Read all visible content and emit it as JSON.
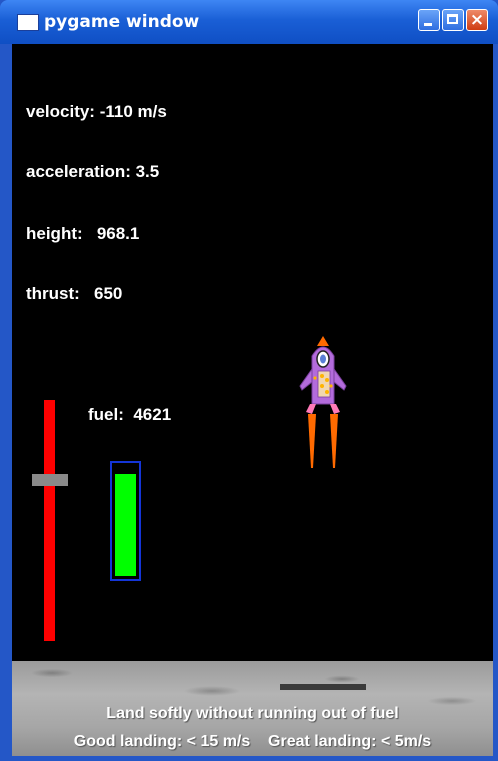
{
  "window": {
    "title": "pygame window",
    "close_glyph": "×"
  },
  "hud": {
    "velocity": "velocity: -110 m/s",
    "acceleration": "acceleration: 3.5",
    "height": "height:   968.1",
    "thrust": "thrust:   650",
    "fuel": "fuel:  4621"
  },
  "gauges": {
    "fuel_level": 0.93,
    "thrust_level": 0.67
  },
  "messages": {
    "line1": "Land softly without running out of fuel",
    "line2": "Good landing: < 15 m/s    Great landing: < 5m/s"
  },
  "colors": {
    "thrust_track": "#ff0000",
    "fuel_fill": "#00ff00",
    "fuel_frame": "#1435d8",
    "rocket_body": "#b36bdc",
    "rocket_nose": "#ff6a00",
    "flame": "#ff6a00"
  }
}
